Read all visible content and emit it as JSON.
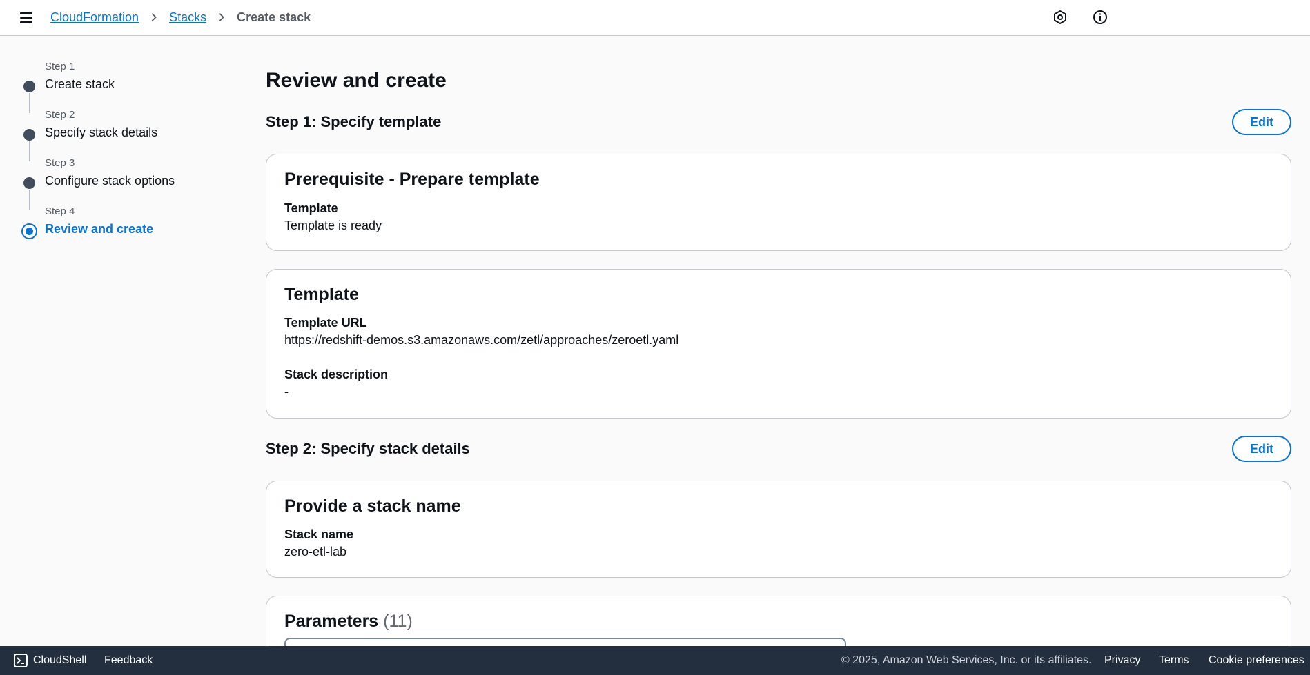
{
  "header": {
    "breadcrumbs": [
      "CloudFormation",
      "Stacks",
      "Create stack"
    ]
  },
  "steps": [
    {
      "num": "Step 1",
      "label": "Create stack"
    },
    {
      "num": "Step 2",
      "label": "Specify stack details"
    },
    {
      "num": "Step 3",
      "label": "Configure stack options"
    },
    {
      "num": "Step 4",
      "label": "Review and create",
      "active": true
    }
  ],
  "main": {
    "title": "Review and create",
    "section1": {
      "title": "Step 1: Specify template",
      "edit_label": "Edit",
      "prereq_card": {
        "title": "Prerequisite - Prepare template",
        "template_label": "Template",
        "template_value": "Template is ready"
      },
      "template_card": {
        "title": "Template",
        "url_label": "Template URL",
        "url_value": "https://redshift-demos.s3.amazonaws.com/zetl/approaches/zeroetl.yaml",
        "desc_label": "Stack description",
        "desc_value": "-"
      }
    },
    "section2": {
      "title": "Step 2: Specify stack details",
      "edit_label": "Edit",
      "name_card": {
        "title": "Provide a stack name",
        "name_label": "Stack name",
        "name_value": "zero-etl-lab"
      },
      "params_card": {
        "title": "Parameters",
        "count": "(11)"
      }
    }
  },
  "footer": {
    "cloudshell": "CloudShell",
    "feedback": "Feedback",
    "copyright": "© 2025, Amazon Web Services, Inc. or its affiliates.",
    "privacy": "Privacy",
    "terms": "Terms",
    "cookies": "Cookie preferences"
  },
  "colors": {
    "link": "#0972d3",
    "footer_bg": "#232f3e"
  }
}
